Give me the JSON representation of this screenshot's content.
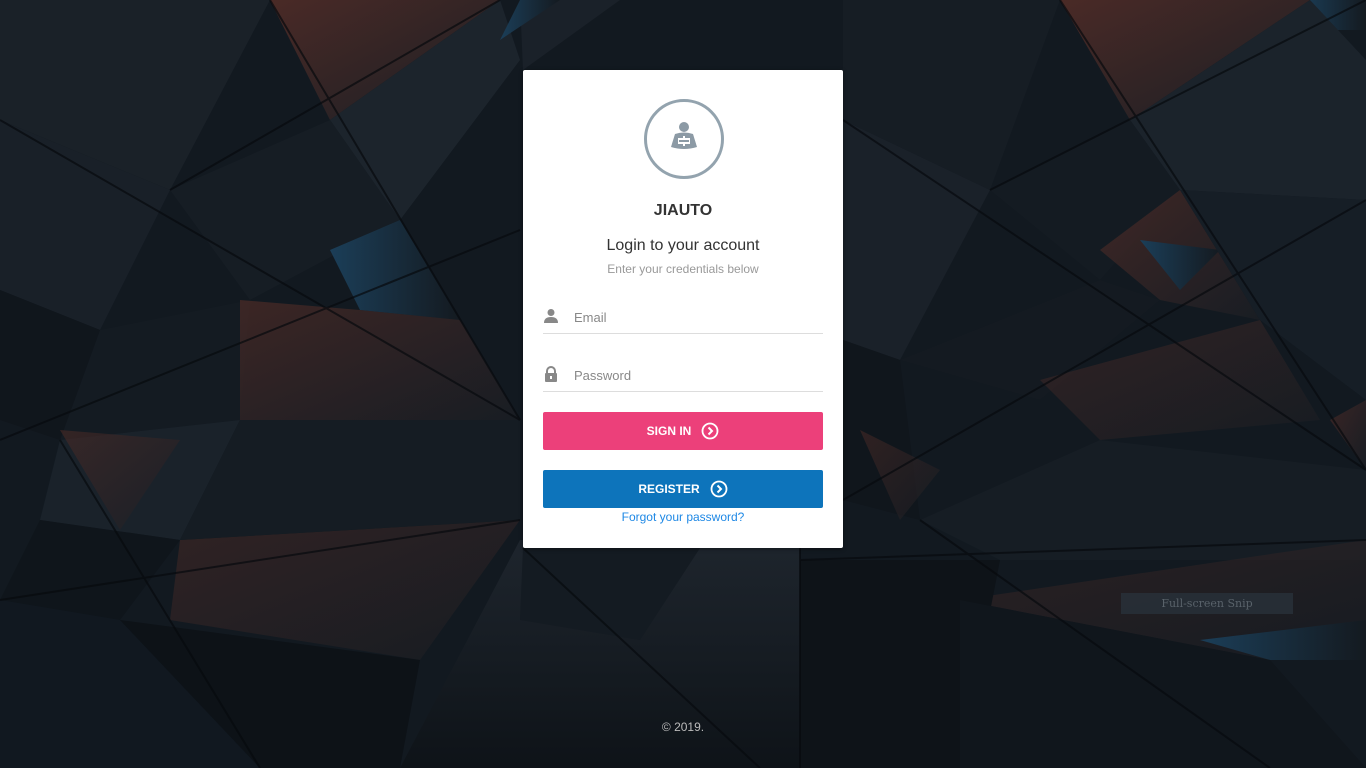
{
  "brand": {
    "name": "JIAUTO",
    "logo_icon": "reading-person-icon"
  },
  "login": {
    "heading": "Login to your account",
    "subheading": "Enter your credentials below",
    "email": {
      "icon": "user-icon",
      "placeholder": "Email",
      "value": ""
    },
    "password": {
      "icon": "lock-icon",
      "placeholder": "Password",
      "value": ""
    },
    "signin_label": "SIGN IN",
    "register_label": "REGISTER",
    "button_icon": "circle-arrow-right-icon",
    "forgot_label": "Forgot your password?"
  },
  "overlay": {
    "snip_label": "Full-screen Snip"
  },
  "footer": {
    "copyright": "© 2019."
  },
  "colors": {
    "signin": "#ec407a",
    "register": "#0d74bb",
    "link": "#1e88e5",
    "background": "#111820"
  }
}
